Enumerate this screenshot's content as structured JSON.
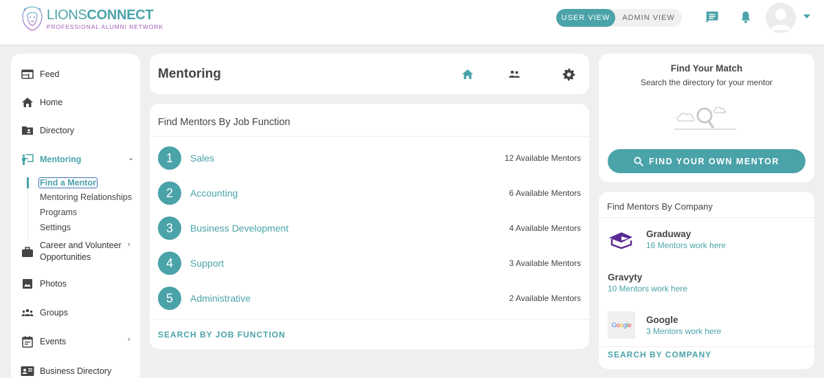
{
  "brand": {
    "name_light": "LIONS",
    "name_bold": "CONNECT",
    "tagline": "PROFESSIONAL ALUMNI NETWORK",
    "accent_color": "#4aa3a9",
    "tagline_color": "#a05bb7"
  },
  "header": {
    "view_toggle": {
      "options": [
        "USER VIEW",
        "ADMIN VIEW"
      ],
      "selected": "USER VIEW"
    },
    "icons": [
      "chat-icon",
      "bell-icon",
      "avatar",
      "caret-down-icon"
    ]
  },
  "sidebar": {
    "items": [
      {
        "label": "Feed",
        "icon": "feed-icon"
      },
      {
        "label": "Home",
        "icon": "home-icon"
      },
      {
        "label": "Directory",
        "icon": "directory-icon"
      },
      {
        "label": "Mentoring",
        "icon": "mentoring-icon",
        "active": true,
        "expanded": true
      },
      {
        "label": "Career and Volunteer Opportunities",
        "line1": "Career and Volunteer",
        "line2": "Opportunities",
        "icon": "briefcase-icon"
      },
      {
        "label": "Photos",
        "icon": "photo-icon"
      },
      {
        "label": "Groups",
        "icon": "groups-icon"
      },
      {
        "label": "Events",
        "icon": "events-icon"
      },
      {
        "label": "Business Directory",
        "icon": "business-card-icon"
      }
    ],
    "mentoring_sub": [
      "Find a Mentor",
      "Mentoring Relationships",
      "Programs",
      "Settings"
    ],
    "mentoring_sub_selected": "Find a Mentor"
  },
  "page": {
    "title": "Mentoring",
    "tabs": [
      "home-icon",
      "people-icon",
      "gear-icon"
    ],
    "active_tab": "home-icon"
  },
  "job_function": {
    "header": "Find Mentors By Job Function",
    "rows": [
      {
        "num": "1",
        "name": "Sales",
        "count": "12 Available Mentors"
      },
      {
        "num": "2",
        "name": "Accounting",
        "count": "6 Available Mentors"
      },
      {
        "num": "3",
        "name": "Business Development",
        "count": "4 Available Mentors"
      },
      {
        "num": "4",
        "name": "Support",
        "count": "3 Available Mentors"
      },
      {
        "num": "5",
        "name": "Administrative",
        "count": "2 Available Mentors"
      }
    ],
    "footer_link": "SEARCH BY JOB FUNCTION"
  },
  "match": {
    "title": "Find Your Match",
    "subtitle": "Search the directory for your mentor",
    "button": "FIND YOUR OWN MENTOR"
  },
  "company": {
    "header": "Find Mentors By Company",
    "rows": [
      {
        "name": "Graduway",
        "count": "16 Mentors work here",
        "logo": "graduation-cap-icon"
      },
      {
        "name": "Gravyty",
        "count": "10 Mentors work here",
        "logo": null
      },
      {
        "name": "Google",
        "count": "3 Mentors work here",
        "logo": "google-logo"
      }
    ],
    "footer_link": "SEARCH BY COMPANY"
  }
}
